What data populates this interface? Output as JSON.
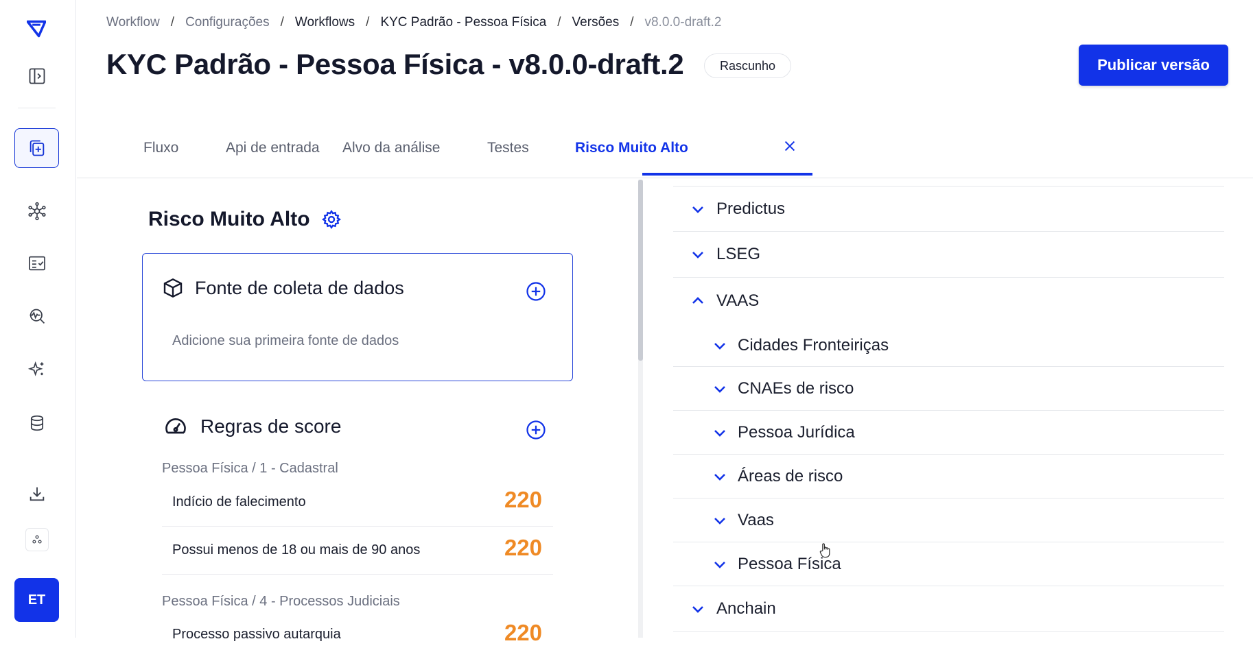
{
  "sidebar": {
    "items": [
      {
        "icon": "logo-icon"
      },
      {
        "icon": "panel-toggle-icon"
      },
      {
        "icon": "add-document-icon",
        "active": true
      },
      {
        "icon": "network-icon"
      },
      {
        "icon": "checklist-icon"
      },
      {
        "icon": "search-analytics-icon"
      },
      {
        "icon": "sparkles-icon"
      },
      {
        "icon": "database-icon"
      },
      {
        "icon": "download-icon"
      },
      {
        "icon": "apps-icon"
      }
    ],
    "avatar_initials": "ET"
  },
  "breadcrumb": [
    "Workflow",
    "Configurações",
    "Workflows",
    "KYC Padrão - Pessoa Física",
    "Versões",
    "v8.0.0-draft.2"
  ],
  "header": {
    "title": "KYC Padrão - Pessoa Física - v8.0.0-draft.2",
    "status": "Rascunho",
    "publish_label": "Publicar versão"
  },
  "tabs": [
    "Fluxo",
    "Api de entrada",
    "Alvo da análise",
    "Testes",
    "Risco Muito Alto"
  ],
  "active_tab": "Risco Muito Alto",
  "left_panel": {
    "title": "Risco Muito Alto",
    "data_source_card": {
      "title": "Fonte de coleta de dados",
      "empty_text": "Adicione sua primeira fonte de dados"
    },
    "score_rules": {
      "title": "Regras de score",
      "groups": [
        {
          "label": "Pessoa Física / 1 - Cadastral",
          "rules": [
            {
              "name": "Indício de falecimento",
              "score": "220"
            },
            {
              "name": "Possui menos de 18 ou mais de 90 anos",
              "score": "220"
            }
          ]
        },
        {
          "label": "Pessoa Física / 4 - Processos Judiciais",
          "rules": [
            {
              "name": "Processo passivo autarquia",
              "score": "220"
            }
          ]
        }
      ]
    }
  },
  "right_panel": {
    "tree": [
      {
        "label": "Predictus",
        "expanded": false,
        "level": 0
      },
      {
        "label": "LSEG",
        "expanded": false,
        "level": 0
      },
      {
        "label": "VAAS",
        "expanded": true,
        "level": 0
      },
      {
        "label": "Cidades Fronteiriças",
        "expanded": false,
        "level": 1
      },
      {
        "label": "CNAEs de risco",
        "expanded": false,
        "level": 1
      },
      {
        "label": "Pessoa Jurídica",
        "expanded": false,
        "level": 1
      },
      {
        "label": "Áreas de risco",
        "expanded": false,
        "level": 1
      },
      {
        "label": "Vaas",
        "expanded": false,
        "level": 1
      },
      {
        "label": "Pessoa Física",
        "expanded": false,
        "level": 1
      },
      {
        "label": "Anchain",
        "expanded": false,
        "level": 0
      }
    ]
  },
  "colors": {
    "accent": "#1233e8",
    "score": "#ef8a25",
    "text": "#14182b",
    "muted": "#6b7080"
  }
}
